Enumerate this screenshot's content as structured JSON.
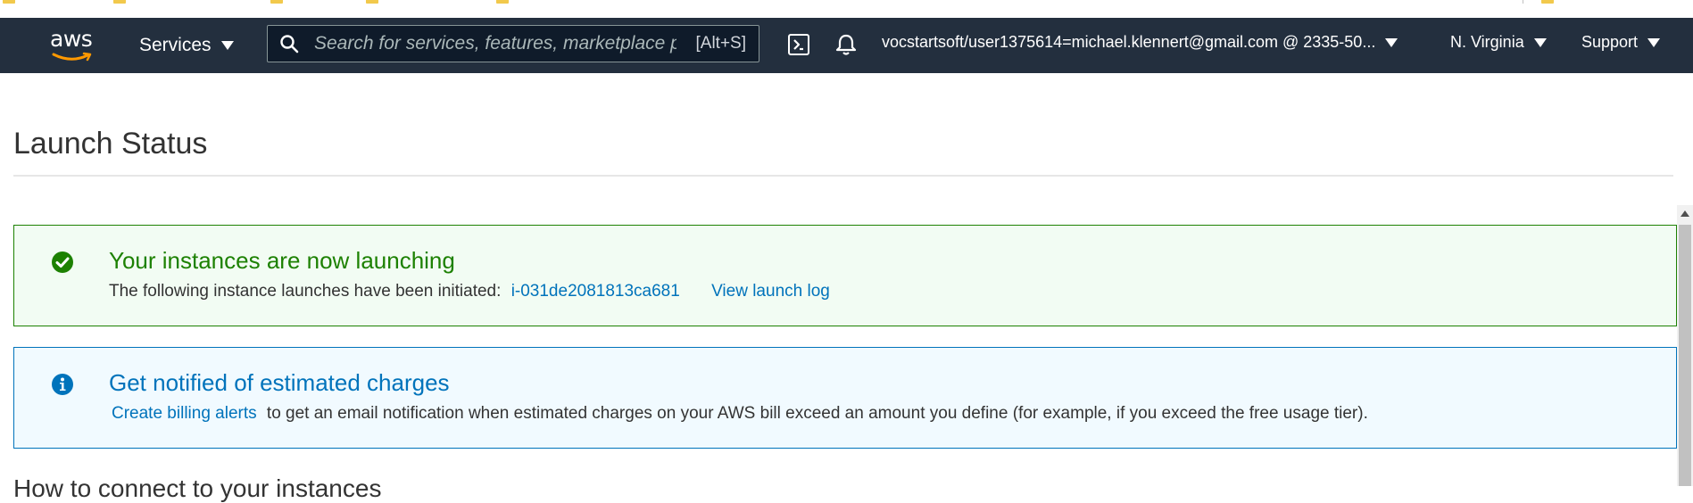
{
  "nav": {
    "logo_text": "aws",
    "services_label": "Services",
    "search": {
      "placeholder": "Search for services, features, marketplace products, and docs",
      "shortcut": "[Alt+S]"
    },
    "account_label": "vocstartsoft/user1375614=michael.klennert@gmail.com @ 2335-50...",
    "region_label": "N. Virginia",
    "support_label": "Support"
  },
  "main": {
    "title": "Launch Status",
    "success": {
      "title": "Your instances are now launching",
      "body_prefix": "The following instance launches have been initiated:",
      "instance_id": "i-031de2081813ca681",
      "log_link": "View launch log"
    },
    "info": {
      "title": "Get notified of estimated charges",
      "link": "Create billing alerts",
      "body_suffix": "to get an email notification when estimated charges on your AWS bill exceed an amount you define (for example, if you exceed the free usage tier)."
    },
    "next_section_title": "How to connect to your instances"
  },
  "colors": {
    "nav_bg": "#232f3e",
    "success": "#1d8102",
    "info": "#0073bb",
    "link": "#0073bb"
  },
  "icons": [
    "search-icon",
    "cloudshell-icon",
    "bell-icon",
    "check-circle-icon",
    "info-circle-icon"
  ]
}
